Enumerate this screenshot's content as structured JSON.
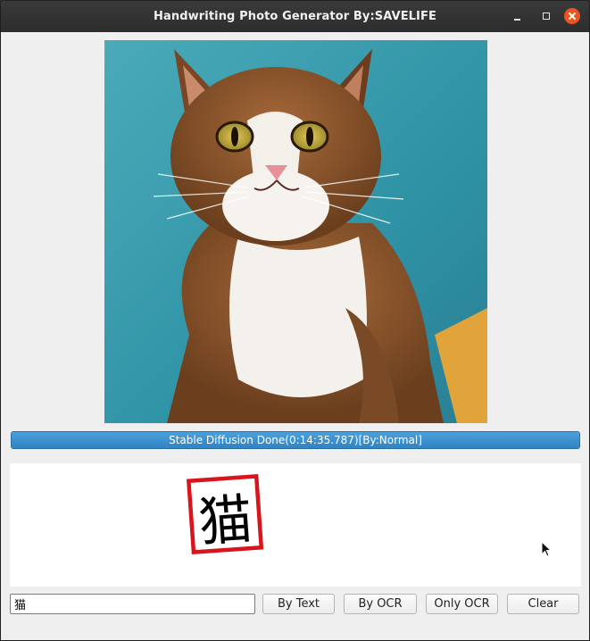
{
  "window": {
    "title": "Handwriting Photo Generator By:SAVELIFE"
  },
  "photo": {
    "subject": "cat portrait",
    "background_color": "#3aa0b2"
  },
  "progress": {
    "value_percent": 100,
    "text": "Stable Diffusion Done(0:14:35.787)[By:Normal]",
    "color": "#3b8fd0"
  },
  "canvas": {
    "character": "猫",
    "stamp_color": "#d8141c"
  },
  "input": {
    "value": "猫"
  },
  "buttons": {
    "by_text": "By Text",
    "by_ocr": "By OCR",
    "only_ocr": "Only OCR",
    "clear": "Clear"
  },
  "icons": {
    "minimize": "minimize-icon",
    "maximize": "maximize-icon",
    "close": "close-icon",
    "cursor": "mouse-pointer-icon"
  }
}
